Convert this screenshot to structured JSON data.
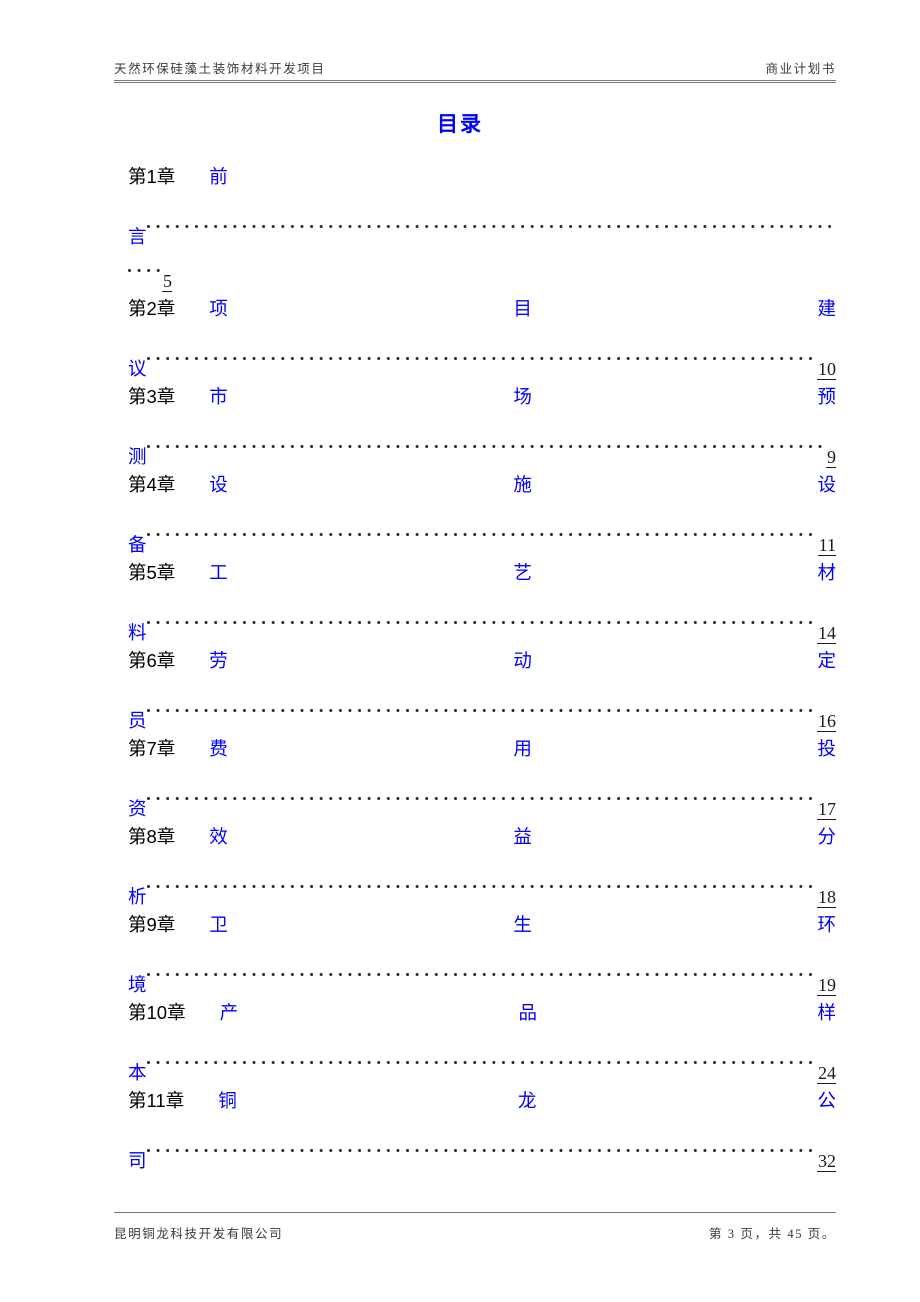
{
  "header": {
    "left_text": "天然环保硅藻土装饰材料开发项目",
    "right_text": "商业计划书"
  },
  "title": "目录",
  "colors": {
    "entry_title": "#0000FF",
    "chapter_label": "#000000",
    "page_number": "#1A1A1A",
    "rule": "#7A7A7A",
    "leader_dot": "#2B2B2B"
  },
  "toc": {
    "entries": [
      {
        "chapter_label": "第1章",
        "title_chars": [
          "前"
        ],
        "tail_char": "言",
        "page": "5",
        "wraps_extra_line": true,
        "justified": false,
        "full_title": "前言"
      },
      {
        "chapter_label": "第2章",
        "title_chars": [
          "项",
          "目",
          "建"
        ],
        "tail_char": "议",
        "page": "10",
        "wraps_extra_line": false,
        "justified": true,
        "full_title": "项目建议"
      },
      {
        "chapter_label": "第3章",
        "title_chars": [
          "市",
          "场",
          "预"
        ],
        "tail_char": "测",
        "page": "9",
        "wraps_extra_line": false,
        "justified": true,
        "full_title": "市场预测"
      },
      {
        "chapter_label": "第4章",
        "title_chars": [
          "设",
          "施",
          "设"
        ],
        "tail_char": "备",
        "page": "11",
        "wraps_extra_line": false,
        "justified": true,
        "full_title": "设施设备"
      },
      {
        "chapter_label": "第5章",
        "title_chars": [
          "工",
          "艺",
          "材"
        ],
        "tail_char": "料",
        "page": "14",
        "wraps_extra_line": false,
        "justified": true,
        "full_title": "工艺材料"
      },
      {
        "chapter_label": "第6章",
        "title_chars": [
          "劳",
          "动",
          "定"
        ],
        "tail_char": "员",
        "page": "16",
        "wraps_extra_line": false,
        "justified": true,
        "full_title": "劳动定员"
      },
      {
        "chapter_label": "第7章",
        "title_chars": [
          "费",
          "用",
          "投"
        ],
        "tail_char": "资",
        "page": "17",
        "wraps_extra_line": false,
        "justified": true,
        "full_title": "费用投资"
      },
      {
        "chapter_label": "第8章",
        "title_chars": [
          "效",
          "益",
          "分"
        ],
        "tail_char": "析",
        "page": "18",
        "wraps_extra_line": false,
        "justified": true,
        "full_title": "效益分析"
      },
      {
        "chapter_label": "第9章",
        "title_chars": [
          "卫",
          "生",
          "环"
        ],
        "tail_char": "境",
        "page": "19",
        "wraps_extra_line": false,
        "justified": true,
        "full_title": "卫生环境"
      },
      {
        "chapter_label": "第10章",
        "title_chars": [
          "产",
          "品",
          "样"
        ],
        "tail_char": "本",
        "page": "24",
        "wraps_extra_line": false,
        "justified": true,
        "full_title": "产品样本"
      },
      {
        "chapter_label": "第11章",
        "title_chars": [
          "铜",
          "龙",
          "公"
        ],
        "tail_char": "司",
        "page": "32",
        "wraps_extra_line": false,
        "justified": true,
        "full_title": "铜龙公司"
      }
    ]
  },
  "footer": {
    "left_text": "昆明铜龙科技开发有限公司",
    "right_text": "第 3 页，共 45 页。"
  }
}
